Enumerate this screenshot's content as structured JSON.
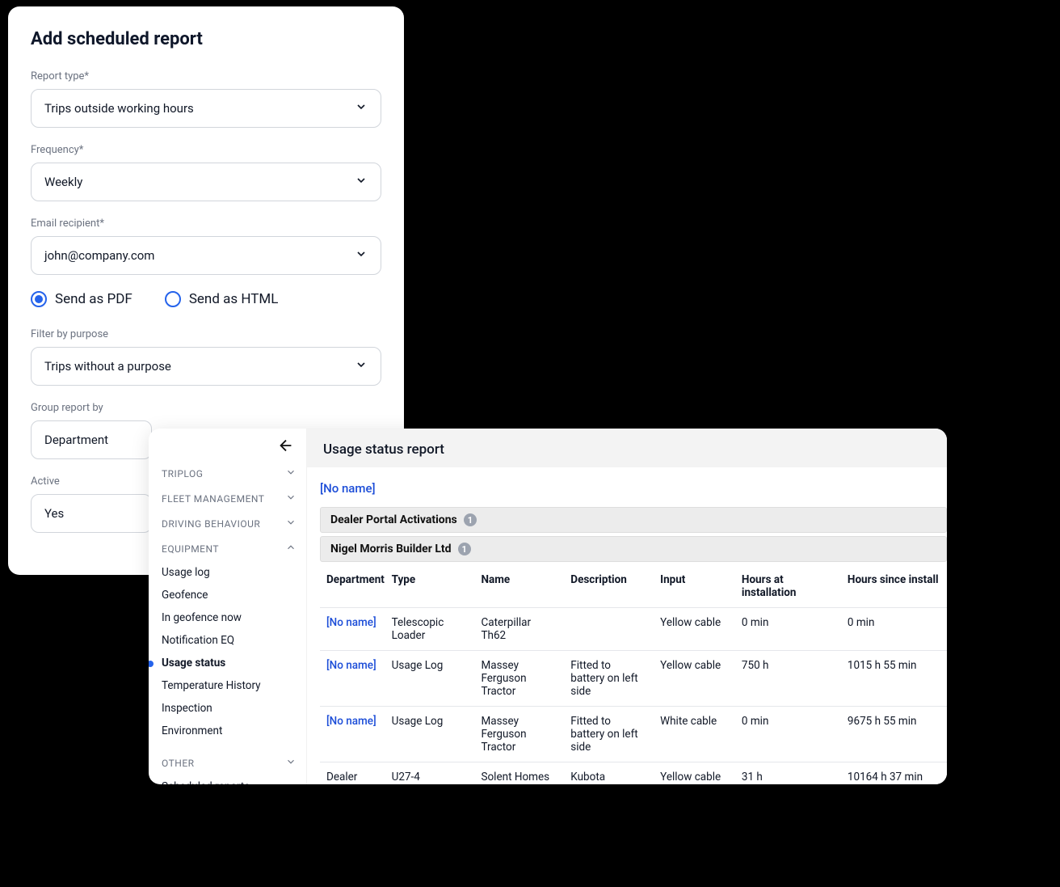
{
  "modal": {
    "title": "Add scheduled report",
    "fields": {
      "report_type": {
        "label": "Report type*",
        "value": "Trips outside working hours"
      },
      "frequency": {
        "label": "Frequency*",
        "value": "Weekly"
      },
      "email": {
        "label": "Email recipient*",
        "value": "john@company.com"
      },
      "format_pdf_label": "Send as PDF",
      "format_html_label": "Send as HTML",
      "filter_purpose": {
        "label": "Filter by purpose",
        "value": "Trips without a purpose"
      },
      "group_by": {
        "label": "Group report by",
        "value": "Department"
      },
      "active": {
        "label": "Active",
        "value": "Yes"
      }
    }
  },
  "sidebar": {
    "sections": {
      "triplog": "TRIPLOG",
      "fleet": "FLEET MANAGEMENT",
      "driving": "DRIVING BEHAVIOUR",
      "equipment": "EQUIPMENT",
      "other": "OTHER"
    },
    "equipment_items": [
      "Usage log",
      "Geofence",
      "In geofence now",
      "Notification EQ",
      "Usage status",
      "Temperature History",
      "Inspection",
      "Environment"
    ],
    "other_items": [
      "Scheduled reports"
    ]
  },
  "report": {
    "title": "Usage status report",
    "noname_link": "[No name]",
    "groups": [
      {
        "name": "Dealer Portal Activations",
        "count": "1"
      },
      {
        "name": "Nigel Morris Builder Ltd",
        "count": "1"
      }
    ],
    "columns": [
      "Department",
      "Type",
      "Name",
      "Description",
      "Input",
      "Hours at installation",
      "Hours since install"
    ],
    "rows": [
      {
        "dept": "[No name]",
        "dept_link": true,
        "type": "Telescopic Loader",
        "name": "Caterpillar Th62",
        "desc": "",
        "input": "Yellow cable",
        "h_install": "0 min",
        "h_since": "0 min"
      },
      {
        "dept": "[No name]",
        "dept_link": true,
        "type": "Usage Log",
        "name": "Massey Ferguson Tractor",
        "desc": "Fitted to battery on left side",
        "input": "Yellow cable",
        "h_install": "750 h",
        "h_since": "1015 h 55 min"
      },
      {
        "dept": "[No name]",
        "dept_link": true,
        "type": "Usage Log",
        "name": "Massey Ferguson Tractor",
        "desc": "Fitted to battery on left side",
        "input": "White cable",
        "h_install": "0 min",
        "h_since": "9675 h 55 min"
      },
      {
        "dept": "Dealer Portal",
        "dept_link": false,
        "type": "U27-4",
        "name": "Solent Homes",
        "desc": "Kubota",
        "input": "Yellow cable",
        "h_install": "31 h",
        "h_since": "10164 h 37 min"
      }
    ]
  }
}
